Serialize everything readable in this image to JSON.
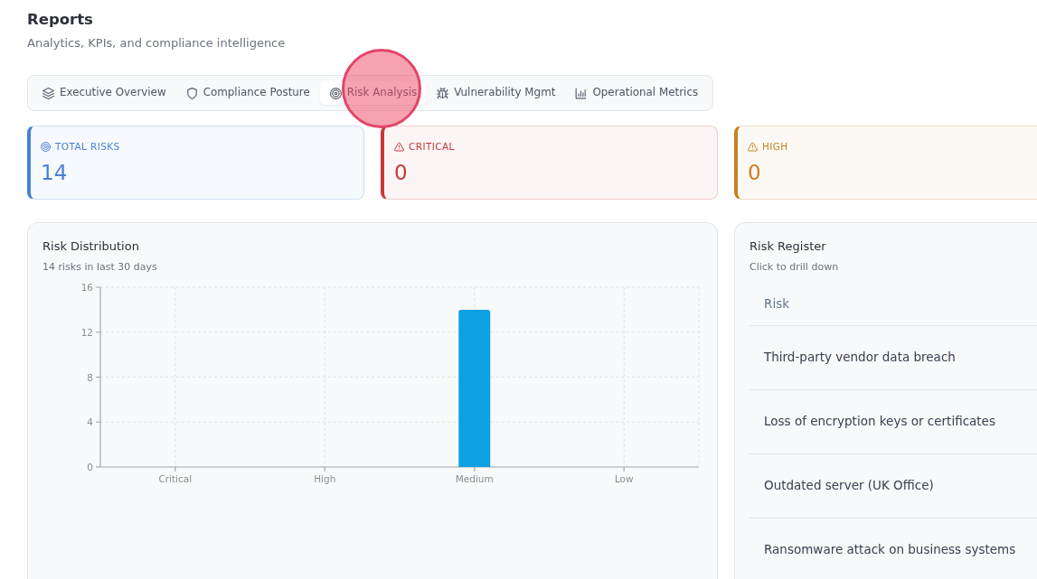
{
  "header": {
    "title": "Reports",
    "subtitle": "Analytics, KPIs, and compliance intelligence"
  },
  "tabs": [
    {
      "label": "Executive Overview",
      "selected": false
    },
    {
      "label": "Compliance Posture",
      "selected": false
    },
    {
      "label": "Risk Analysis",
      "selected": true
    },
    {
      "label": "Vulnerability Mgmt",
      "selected": false
    },
    {
      "label": "Operational Metrics",
      "selected": false
    }
  ],
  "click_highlight": true,
  "stat_cards": [
    {
      "kind": "total",
      "label": "TOTAL RISKS",
      "value": "14",
      "color": "#4a80d4"
    },
    {
      "kind": "critical",
      "label": "CRITICAL",
      "value": "0",
      "color": "#c8363a"
    },
    {
      "kind": "high",
      "label": "HIGH",
      "value": "0",
      "color": "#c9801f"
    }
  ],
  "risk_distribution": {
    "title": "Risk Distribution",
    "subtitle": "14 risks in last 30 days",
    "chart_data": {
      "type": "bar",
      "categories": [
        "Critical",
        "High",
        "Medium",
        "Low"
      ],
      "values": [
        0,
        0,
        14,
        0
      ],
      "ylim": [
        0,
        16
      ],
      "yticks": [
        0,
        4,
        8,
        12,
        16
      ],
      "grid": true
    }
  },
  "risk_register": {
    "title": "Risk Register",
    "subtitle": "Click to drill down",
    "table": {
      "columns": [
        "Risk"
      ],
      "rows": [
        [
          "Third-party vendor data breach"
        ],
        [
          "Loss of encryption keys or certificates"
        ],
        [
          "Outdated server (UK Office)"
        ],
        [
          "Ransomware attack on business systems"
        ]
      ]
    }
  }
}
